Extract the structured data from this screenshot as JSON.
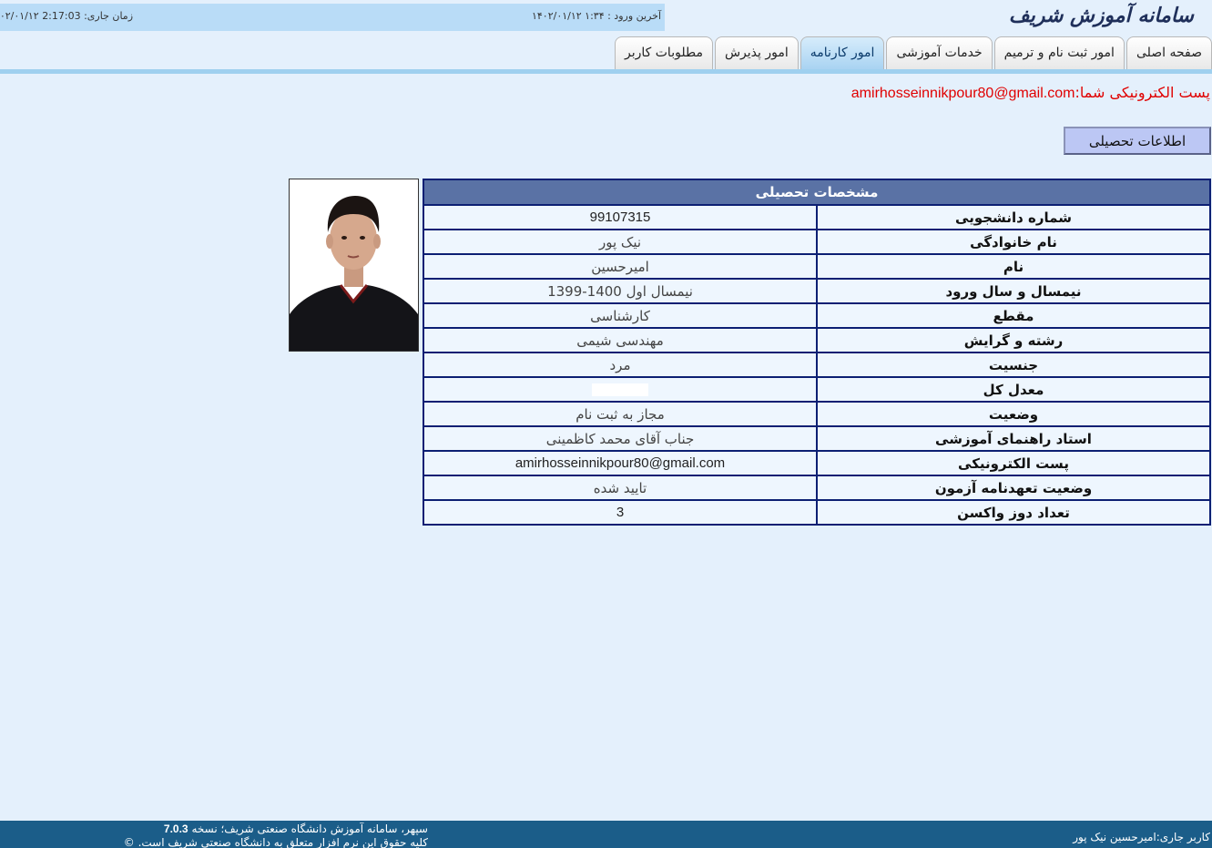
{
  "header": {
    "logo": "سامانه آموزش شریف",
    "last_login": "آخرین ورود : ۱:۳۴ ۱۴۰۲/۰۱/۱۲",
    "current_time": "زمان جاری: 2:17:03 ۱۴۰۲/۰۱/۱۲"
  },
  "tabs": [
    {
      "label": "صفحه اصلی"
    },
    {
      "label": "امور ثبت نام و ترمیم"
    },
    {
      "label": "خدمات آموزشی"
    },
    {
      "label": "امور کارنامه"
    },
    {
      "label": "امور پذیرش"
    },
    {
      "label": "مطلوبات کاربر"
    }
  ],
  "email_notice": {
    "prefix": "پست الکترونیکی شما:",
    "email": "amirhosseinnikpour80@gmail.com"
  },
  "edu_button": "اطلاعات تحصیلی",
  "table": {
    "title": "مشخصات تحصیلی",
    "rows": [
      {
        "label": "شماره دانشجویی",
        "value": "99107315"
      },
      {
        "label": "نام خانوادگی",
        "value": "نیک پور"
      },
      {
        "label": "نام",
        "value": "امیرحسین"
      },
      {
        "label": "نیمسال و سال ورود",
        "value": "نیمسال اول 1400-1399"
      },
      {
        "label": "مقطع",
        "value": "کارشناسی"
      },
      {
        "label": "رشته و گرایش",
        "value": "مهندسی شیمی"
      },
      {
        "label": "جنسیت",
        "value": "مرد"
      },
      {
        "label": "معدل کل",
        "value": ""
      },
      {
        "label": "وضعیت",
        "value": "مجاز به ثبت نام"
      },
      {
        "label": "استاد راهنمای آموزشی",
        "value": "جناب آقای محمد کاظمینی"
      },
      {
        "label": "پست الکترونیکی",
        "value": "amirhosseinnikpour80@gmail.com"
      },
      {
        "label": "وضعیت تعهدنامه آزمون",
        "value": "تایید شده"
      },
      {
        "label": "تعداد دوز واکسن",
        "value": "3"
      }
    ]
  },
  "footer": {
    "current_user": "کاربر جاری:امیرحسین نیک پور",
    "system_line": "سپهر، سامانه آموزش دانشگاه صنعتی شریف؛ نسخه",
    "version": "7.0.3",
    "copyright": "کلیه حقوق این نرم افزار متعلق به دانشگاه صنعتی شریف است. ©"
  }
}
